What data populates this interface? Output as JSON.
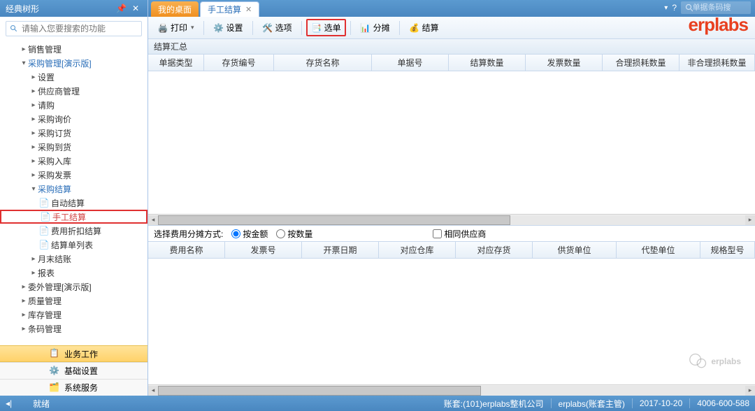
{
  "sidebar": {
    "title": "经典树形",
    "search_placeholder": "请输入您要搜索的功能",
    "tree": {
      "sales": "销售管理",
      "purchase": "采购管理[演示版]",
      "settings": "设置",
      "supplier": "供应商管理",
      "request": "请购",
      "inquiry": "采购询价",
      "order": "采购订货",
      "arrival": "采购到货",
      "stockin": "采购入库",
      "invoice": "采购发票",
      "settle": "采购结算",
      "auto_settle": "自动结算",
      "manual_settle": "手工结算",
      "discount_settle": "费用折扣结算",
      "settle_list": "结算单列表",
      "monthend": "月末结账",
      "report": "报表",
      "outsource": "委外管理[演示版]",
      "quality": "质量管理",
      "inventory": "库存管理",
      "barcode": "条码管理"
    },
    "categories": {
      "business": "业务工作",
      "basic": "基础设置",
      "system": "系统服务"
    }
  },
  "tabs": {
    "desktop": "我的桌面",
    "manual_settle": "手工结算"
  },
  "top_search_placeholder": "单据条码搜",
  "logo": "erplabs",
  "toolbar": {
    "print": "打印",
    "settings": "设置",
    "options": "选项",
    "select_order": "选单",
    "allocate": "分摊",
    "settle": "结算"
  },
  "grid1": {
    "title": "结算汇总",
    "headers": [
      "单据类型",
      "存货编号",
      "存货名称",
      "单据号",
      "结算数量",
      "发票数量",
      "合理损耗数量",
      "非合理损耗数量"
    ]
  },
  "options_bar": {
    "label": "选择费用分摊方式:",
    "by_amount": "按金额",
    "by_qty": "按数量",
    "same_supplier": "相同供应商"
  },
  "grid2": {
    "headers": [
      "费用名称",
      "发票号",
      "开票日期",
      "对应仓库",
      "对应存货",
      "供货单位",
      "代垫单位",
      "规格型号"
    ]
  },
  "status": {
    "ready": "就绪",
    "account": "账套:(101)erplabs整机公司",
    "user": "erplabs(账套主管)",
    "date": "2017-10-20",
    "phone": "4006-600-588"
  },
  "watermark": "erplabs"
}
